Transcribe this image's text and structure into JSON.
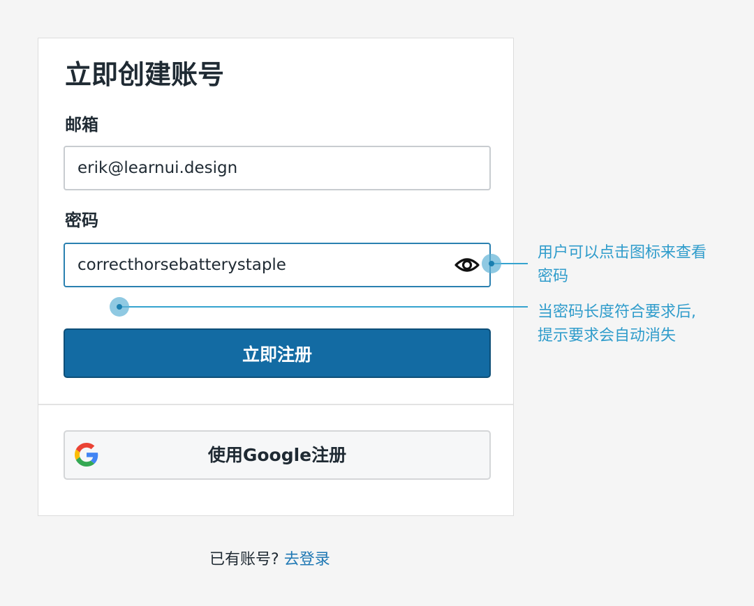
{
  "form": {
    "title": "立即创建账号",
    "email_label": "邮箱",
    "email_value": "erik@learnui.design",
    "password_label": "密码",
    "password_value": "correcthorsebatterystaple",
    "eye_icon": "eye-icon",
    "submit_label": "立即注册",
    "google_icon": "google-logo-icon",
    "google_label": "使用Google注册"
  },
  "footer": {
    "prompt": "已有账号?",
    "login_link": "去登录"
  },
  "annotations": {
    "eye": {
      "line1": "用户可以点击图标来查看",
      "line2": "密码"
    },
    "requirements": {
      "line1": "当密码长度符合要求后,",
      "line2": "提示要求会自动消失"
    }
  },
  "colors": {
    "primary": "#136ba3",
    "annotation": "#2f9ccb",
    "background": "#f5f5f5"
  }
}
